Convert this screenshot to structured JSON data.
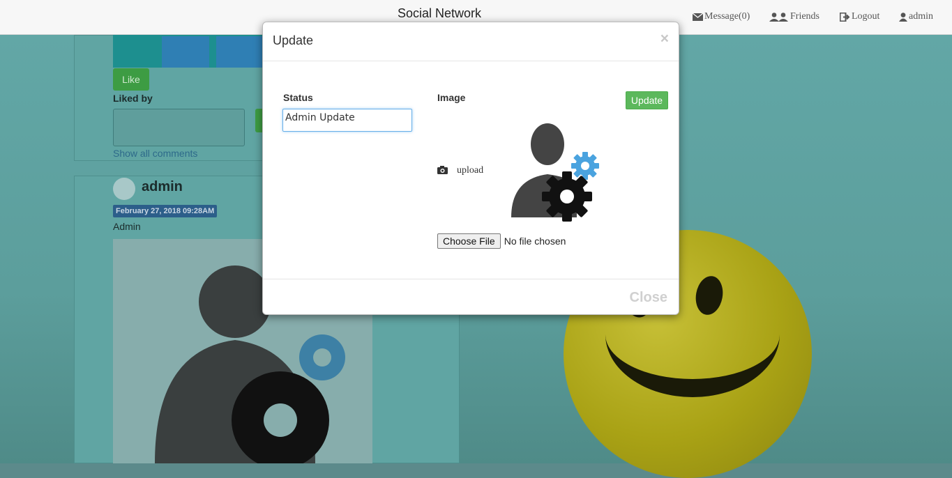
{
  "navbar": {
    "brand": "Social Network",
    "message_label": "Message(0)",
    "friends_label": "Friends",
    "logout_label": "Logout",
    "user_label": "admin"
  },
  "background": {
    "like_label": "Like",
    "liked_by_label": "Liked by",
    "show_comments": "Show all comments",
    "post": {
      "username": "admin",
      "date": "February 27, 2018 09:28AM",
      "text": "Admin"
    }
  },
  "modal": {
    "title": "Update",
    "close_x": "×",
    "status_label": "Status",
    "status_value": "Admin Update",
    "image_label": "Image",
    "update_button": "Update",
    "upload_label": "upload",
    "choose_file": "Choose File",
    "no_file": "No file chosen",
    "close_button": "Close"
  },
  "colors": {
    "accent_green": "#5cb85c",
    "input_focus": "#66afe9",
    "gear_blue": "#4aa3df"
  },
  "icons": [
    "envelope-icon",
    "friends-icon",
    "logout-icon",
    "user-icon",
    "camera-icon",
    "gear-icon"
  ]
}
